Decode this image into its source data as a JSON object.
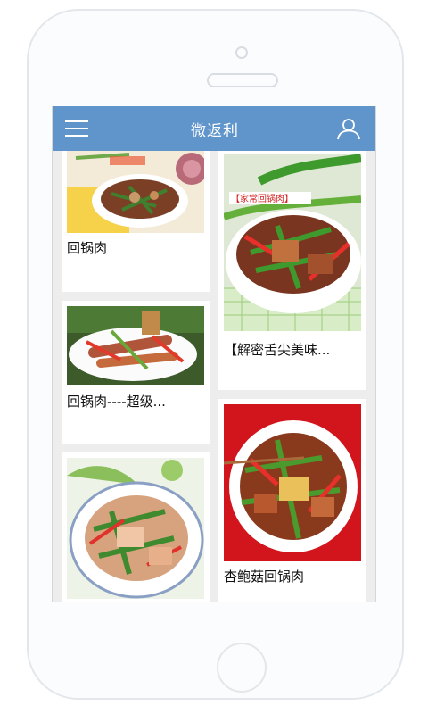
{
  "header": {
    "title": "微返利"
  },
  "icons": {
    "menu": "menu-icon",
    "user": "user-icon"
  },
  "colors": {
    "header_bg": "#5f95cb",
    "background": "#ededed"
  },
  "left_column": [
    {
      "label": "回锅肉"
    },
    {
      "label": "回锅肉----超级..."
    },
    {
      "label": ""
    }
  ],
  "right_column": [
    {
      "label": "【解密舌尖美味...",
      "image_caption": "【家常回锅肉】"
    },
    {
      "label": "杏鲍菇回锅肉"
    }
  ]
}
